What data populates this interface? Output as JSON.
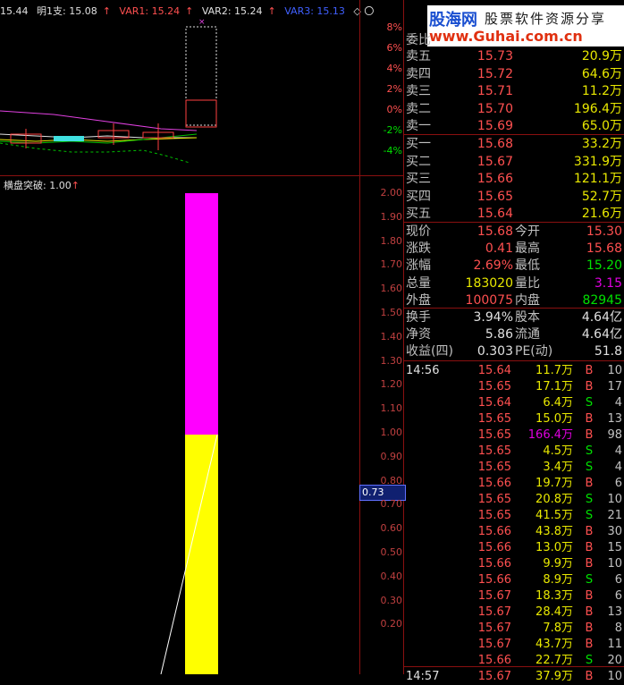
{
  "top_legend": {
    "val0": "15.44",
    "ming": "明1支: 15.08",
    "var1": "VAR1: 15.24",
    "var2": "VAR2: 15.24",
    "var3": "VAR3: 15.13",
    "icons": "◇ 〇"
  },
  "pct_axis": [
    "8%",
    "6%",
    "4%",
    "2%",
    "0%",
    "-2%",
    "-4%"
  ],
  "indicator": {
    "title": "横盘突破: 1.00",
    "axis": [
      "2.00",
      "1.90",
      "1.80",
      "1.70",
      "1.60",
      "1.50",
      "1.40",
      "1.30",
      "1.20",
      "1.10",
      "1.00",
      "0.90",
      "0.80",
      "0.70",
      "0.60",
      "0.50",
      "0.40",
      "0.30",
      "0.20"
    ],
    "current_marker": "0.73",
    "colors": {
      "upper": "#ff00ff",
      "lower": "#ffff00"
    }
  },
  "logo": {
    "line1a": "股海网",
    "line1b": "股票软件资源分享",
    "line2": "www.Guhai.com.cn"
  },
  "weibi_label": "委比",
  "asks": [
    {
      "label": "卖五",
      "price": "15.73",
      "vol": "20.9万"
    },
    {
      "label": "卖四",
      "price": "15.72",
      "vol": "64.6万"
    },
    {
      "label": "卖三",
      "price": "15.71",
      "vol": "11.2万"
    },
    {
      "label": "卖二",
      "price": "15.70",
      "vol": "196.4万"
    },
    {
      "label": "卖一",
      "price": "15.69",
      "vol": "65.0万"
    }
  ],
  "bids": [
    {
      "label": "买一",
      "price": "15.68",
      "vol": "33.2万"
    },
    {
      "label": "买二",
      "price": "15.67",
      "vol": "331.9万"
    },
    {
      "label": "买三",
      "price": "15.66",
      "vol": "121.1万"
    },
    {
      "label": "买四",
      "price": "15.65",
      "vol": "52.7万"
    },
    {
      "label": "买五",
      "price": "15.64",
      "vol": "21.6万"
    }
  ],
  "stats": [
    {
      "l1": "现价",
      "v1": "15.68",
      "l2": "今开",
      "v2": "15.30"
    },
    {
      "l1": "涨跌",
      "v1": "0.41",
      "l2": "最高",
      "v2": "15.68"
    },
    {
      "l1": "涨幅",
      "v1": "2.69%",
      "l2": "最低",
      "v2": "15.20"
    },
    {
      "l1": "总量",
      "v1": "183020",
      "l2": "量比",
      "v2": "3.15"
    },
    {
      "l1": "外盘",
      "v1": "100075",
      "l2": "内盘",
      "v2": "82945"
    }
  ],
  "stats2": [
    {
      "l1": "换手",
      "v1": "3.94%",
      "l2": "股本",
      "v2": "4.64亿"
    },
    {
      "l1": "净资",
      "v1": "5.86",
      "l2": "流通",
      "v2": "4.64亿"
    },
    {
      "l1": "收益(四)",
      "v1": "0.303",
      "l2": "PE(动)",
      "v2": "51.8"
    }
  ],
  "ticks_time": "14:56",
  "ticks": [
    {
      "p": "15.64",
      "v": "11.7万",
      "d": "B",
      "n": "10"
    },
    {
      "p": "15.65",
      "v": "17.1万",
      "d": "B",
      "n": "17"
    },
    {
      "p": "15.64",
      "v": "6.4万",
      "d": "S",
      "n": "4"
    },
    {
      "p": "15.65",
      "v": "15.0万",
      "d": "B",
      "n": "13"
    },
    {
      "p": "15.65",
      "v": "166.4万",
      "d": "B",
      "n": "98"
    },
    {
      "p": "15.65",
      "v": "4.5万",
      "d": "S",
      "n": "4"
    },
    {
      "p": "15.65",
      "v": "3.4万",
      "d": "S",
      "n": "4"
    },
    {
      "p": "15.66",
      "v": "19.7万",
      "d": "B",
      "n": "6"
    },
    {
      "p": "15.65",
      "v": "20.8万",
      "d": "S",
      "n": "10"
    },
    {
      "p": "15.65",
      "v": "41.5万",
      "d": "S",
      "n": "21"
    },
    {
      "p": "15.66",
      "v": "43.8万",
      "d": "B",
      "n": "30"
    },
    {
      "p": "15.66",
      "v": "13.0万",
      "d": "B",
      "n": "15"
    },
    {
      "p": "15.66",
      "v": "9.9万",
      "d": "B",
      "n": "10"
    },
    {
      "p": "15.66",
      "v": "8.9万",
      "d": "S",
      "n": "6"
    },
    {
      "p": "15.67",
      "v": "18.3万",
      "d": "B",
      "n": "6"
    },
    {
      "p": "15.67",
      "v": "28.4万",
      "d": "B",
      "n": "13"
    },
    {
      "p": "15.67",
      "v": "7.8万",
      "d": "B",
      "n": "8"
    },
    {
      "p": "15.67",
      "v": "43.7万",
      "d": "B",
      "n": "11"
    },
    {
      "p": "15.66",
      "v": "22.7万",
      "d": "S",
      "n": "20"
    }
  ],
  "ticks_time2": "14:57",
  "ticks_last": {
    "p": "15.67",
    "v": "37.9万",
    "d": "B",
    "n": "10"
  }
}
